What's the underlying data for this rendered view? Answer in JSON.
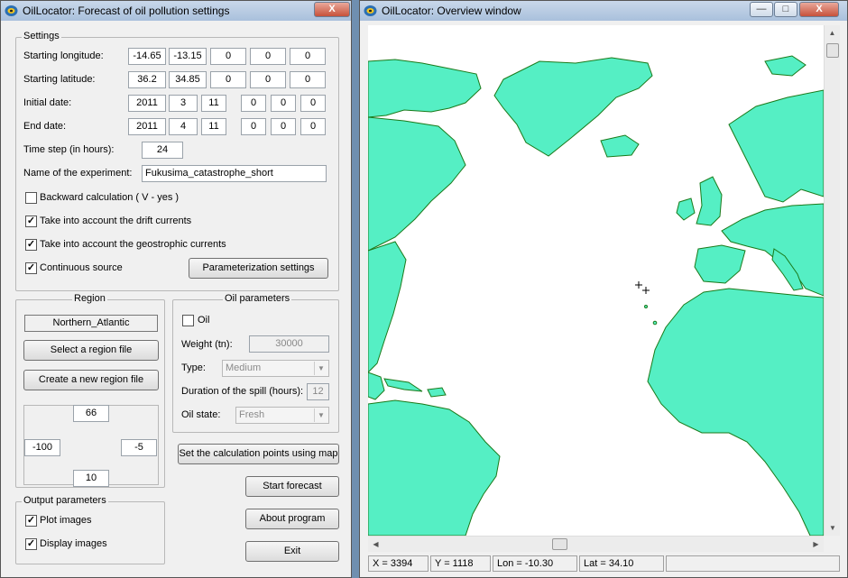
{
  "left_window": {
    "title": "OilLocator: Forecast of oil pollution settings",
    "close_label": "X",
    "settings": {
      "group_label": "Settings",
      "start_lon_label": "Starting longitude:",
      "start_lon": [
        "-14.65",
        "-13.15",
        "0",
        "0",
        "0"
      ],
      "start_lat_label": "Starting latitude:",
      "start_lat": [
        "36.2",
        "34.85",
        "0",
        "0",
        "0"
      ],
      "init_date_label": "Initial date:",
      "init_date": [
        "2011",
        "3",
        "11"
      ],
      "init_time": [
        "0",
        "0",
        "0"
      ],
      "end_date_label": "End date:",
      "end_date": [
        "2011",
        "4",
        "11"
      ],
      "end_time": [
        "0",
        "0",
        "0"
      ],
      "time_step_label": "Time step (in hours):",
      "time_step": "24",
      "experiment_label": "Name of the experiment:",
      "experiment": "Fukusima_catastrophe_short",
      "backward_label": "Backward calculation ( V - yes )",
      "backward": false,
      "drift_label": "Take into account the drift currents",
      "drift": true,
      "geo_label": "Take into account the geostrophic currents",
      "geo": true,
      "continuous_label": "Continuous source",
      "continuous": true,
      "param_button": "Parameterization settings"
    },
    "region": {
      "group_label": "Region",
      "name": "Northern_Atlantic",
      "select_button": "Select a region file",
      "create_button": "Create a new region file",
      "north": "66",
      "west": "-100",
      "east": "-5",
      "south": "10"
    },
    "oil": {
      "group_label": "Oil parameters",
      "oil_label": "Oil",
      "oil_checked": false,
      "weight_label": "Weight (tn):",
      "weight": "30000",
      "type_label": "Type:",
      "type": "Medium",
      "duration_label": "Duration of the spill (hours):",
      "duration": "12",
      "state_label": "Oil state:",
      "state": "Fresh"
    },
    "set_points_button": "Set the calculation points using map",
    "output": {
      "group_label": "Output parameters",
      "plot_label": "Plot images",
      "plot": true,
      "display_label": "Display images",
      "display": true
    },
    "start_button": "Start forecast",
    "about_button": "About program",
    "exit_button": "Exit"
  },
  "right_window": {
    "title": "OilLocator: Overview window",
    "min_label": "—",
    "max_label": "□",
    "close_label": "X",
    "status": {
      "x": "X = 3394",
      "y": "Y = 1118",
      "lon": "Lon = -10.30",
      "lat": "Lat = 34.10"
    }
  },
  "colors": {
    "land": "#55efc4",
    "coast": "#1a7a1a",
    "sea": "#ffffff",
    "marker": "#000000"
  },
  "icons": [
    "oil-drop-icon",
    "minimize-icon",
    "maximize-icon",
    "close-icon",
    "chevron-down-icon",
    "scroll-up-icon",
    "scroll-down-icon",
    "scroll-left-icon",
    "scroll-right-icon"
  ]
}
